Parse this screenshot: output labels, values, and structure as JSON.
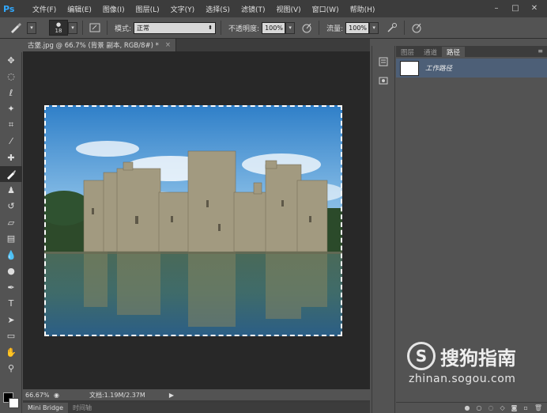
{
  "app": {
    "logo": "Ps",
    "menu": [
      "文件(F)",
      "编辑(E)",
      "图像(I)",
      "图层(L)",
      "文字(Y)",
      "选择(S)",
      "滤镜(T)",
      "视图(V)",
      "窗口(W)",
      "帮助(H)"
    ],
    "window_controls": [
      "–",
      "□",
      "✕"
    ]
  },
  "options": {
    "brush_size": "18",
    "mode_label": "模式:",
    "mode_value": "正常",
    "opacity_label": "不透明度:",
    "opacity_value": "100%",
    "flow_label": "流量:",
    "flow_value": "100%"
  },
  "document": {
    "tab_title": "古堡.jpg @ 66.7% (背景 副本, RGB/8#) *",
    "tab_close": "×",
    "zoom": "66.67%",
    "doc_info": "文档:1.19M/2.37M",
    "status_arrow": "▶"
  },
  "bottom_tabs": [
    "Mini Bridge",
    "时间轴"
  ],
  "panel": {
    "tabs": [
      "图层",
      "通道",
      "路径"
    ],
    "active_tab": "路径",
    "menu_icon": "≡",
    "path_item": "工作路径",
    "footer_icons": [
      "fill-path-icon",
      "stroke-path-icon",
      "load-selection-icon",
      "make-path-icon",
      "add-mask-icon",
      "new-path-icon",
      "delete-icon"
    ]
  },
  "watermark": {
    "logo_letter": "S",
    "brand": "搜狗指南",
    "url": "zhinan.sogou.com"
  },
  "colors": {
    "menubar": "#3c3c3c",
    "workspace": "#282828",
    "panel": "#535353",
    "selected_path": "#4d5f77",
    "ps_blue": "#31a8ff"
  }
}
